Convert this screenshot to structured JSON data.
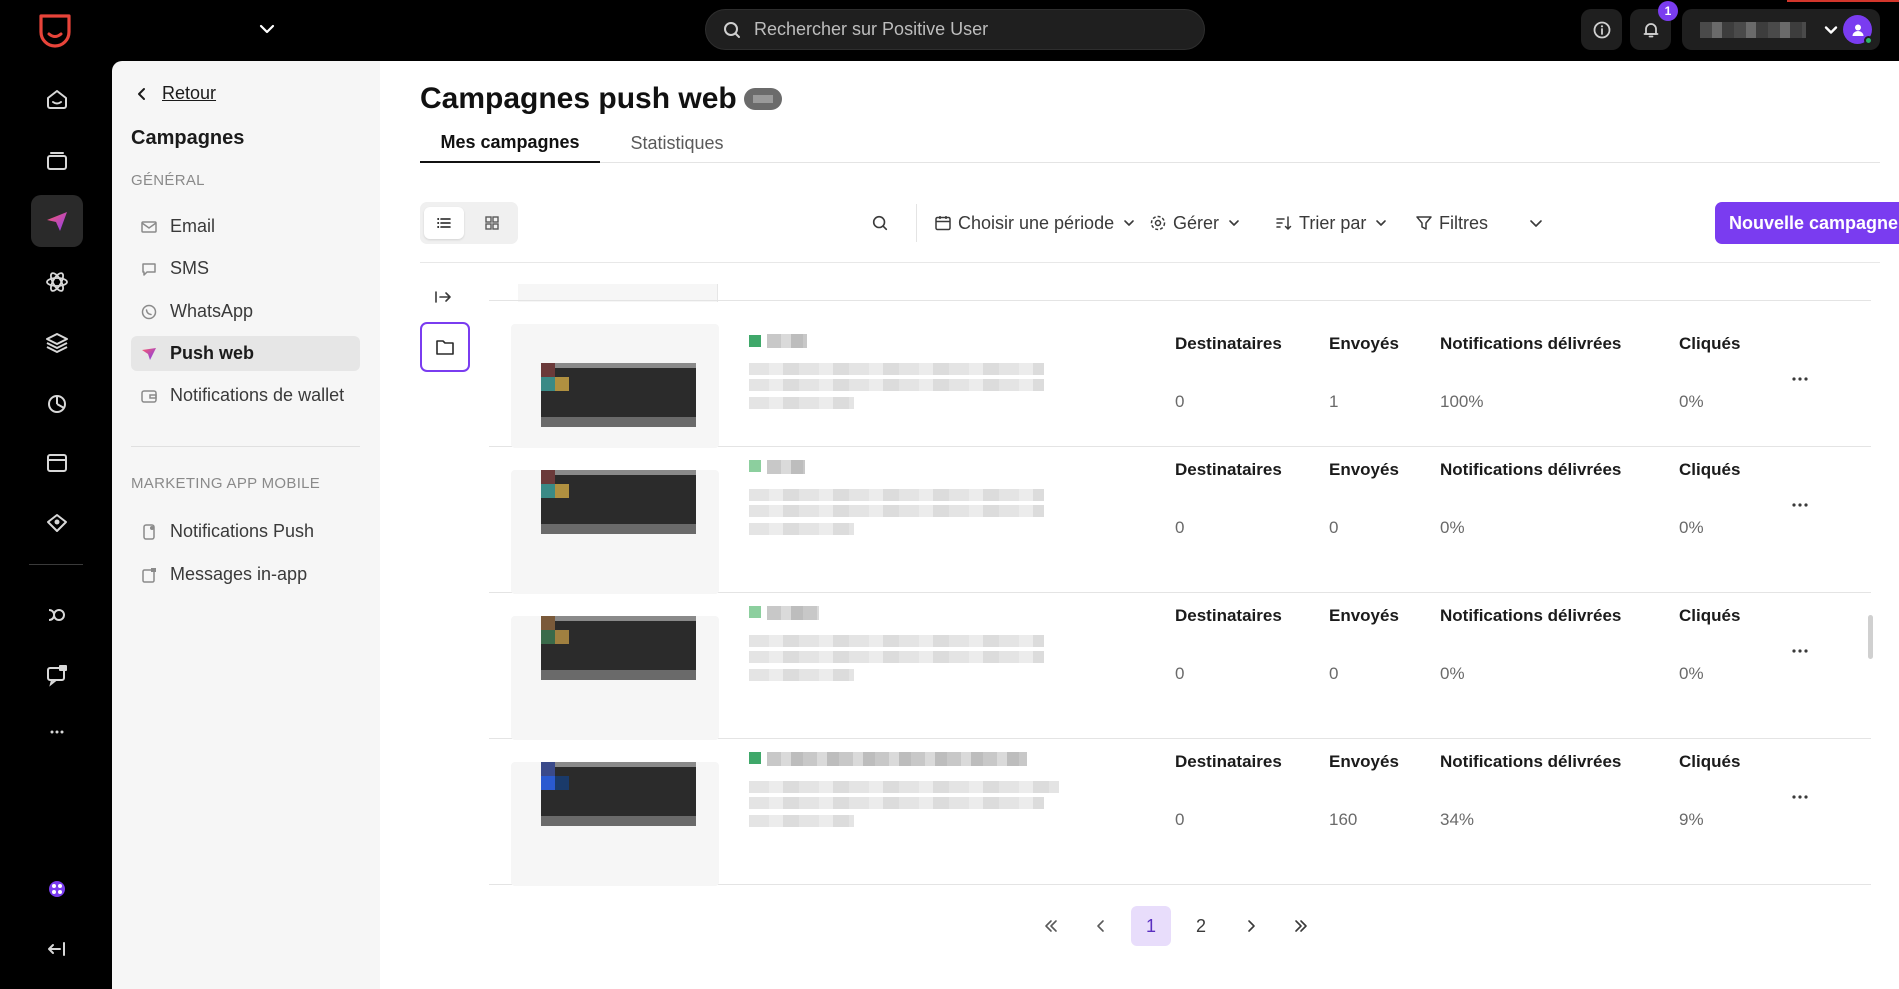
{
  "topbar": {
    "search_placeholder": "Rechercher sur Positive User",
    "notification_count": "1"
  },
  "subnav": {
    "back_label": "Retour",
    "title": "Campagnes",
    "section_general": "GÉNÉRAL",
    "items_general": [
      {
        "label": "Email",
        "icon": "mail-icon"
      },
      {
        "label": "SMS",
        "icon": "sms-icon"
      },
      {
        "label": "WhatsApp",
        "icon": "whatsapp-icon"
      },
      {
        "label": "Push web",
        "icon": "push-web-icon",
        "active": true
      },
      {
        "label": "Notifications de wallet",
        "icon": "wallet-icon"
      }
    ],
    "section_mobile": "MARKETING APP MOBILE",
    "items_mobile": [
      {
        "label": "Notifications Push",
        "icon": "phone-notification-icon"
      },
      {
        "label": "Messages in-app",
        "icon": "in-app-message-icon"
      }
    ]
  },
  "main": {
    "title": "Campagnes push web",
    "tabs": [
      {
        "label": "Mes campagnes",
        "active": true
      },
      {
        "label": "Statistiques",
        "active": false
      }
    ],
    "toolbar": {
      "period": "Choisir une période",
      "manage": "Gérer",
      "sort": "Trier par",
      "filters": "Filtres",
      "new_campaign": "Nouvelle campagne"
    },
    "columns": [
      "Destinataires",
      "Envoyés",
      "Notifications délivrées",
      "Cliqués"
    ],
    "campaigns": [
      {
        "recipients": "0",
        "sent": "1",
        "delivered": "100%",
        "clicked": "0%"
      },
      {
        "recipients": "0",
        "sent": "0",
        "delivered": "0%",
        "clicked": "0%"
      },
      {
        "recipients": "0",
        "sent": "0",
        "delivered": "0%",
        "clicked": "0%"
      },
      {
        "recipients": "0",
        "sent": "160",
        "delivered": "34%",
        "clicked": "9%"
      }
    ],
    "pagination": {
      "pages": [
        "1",
        "2"
      ],
      "current": "1"
    }
  },
  "colors": {
    "accent": "#7a3cf0",
    "brand": "#e8443a",
    "status_dot": "#3fa86a"
  }
}
